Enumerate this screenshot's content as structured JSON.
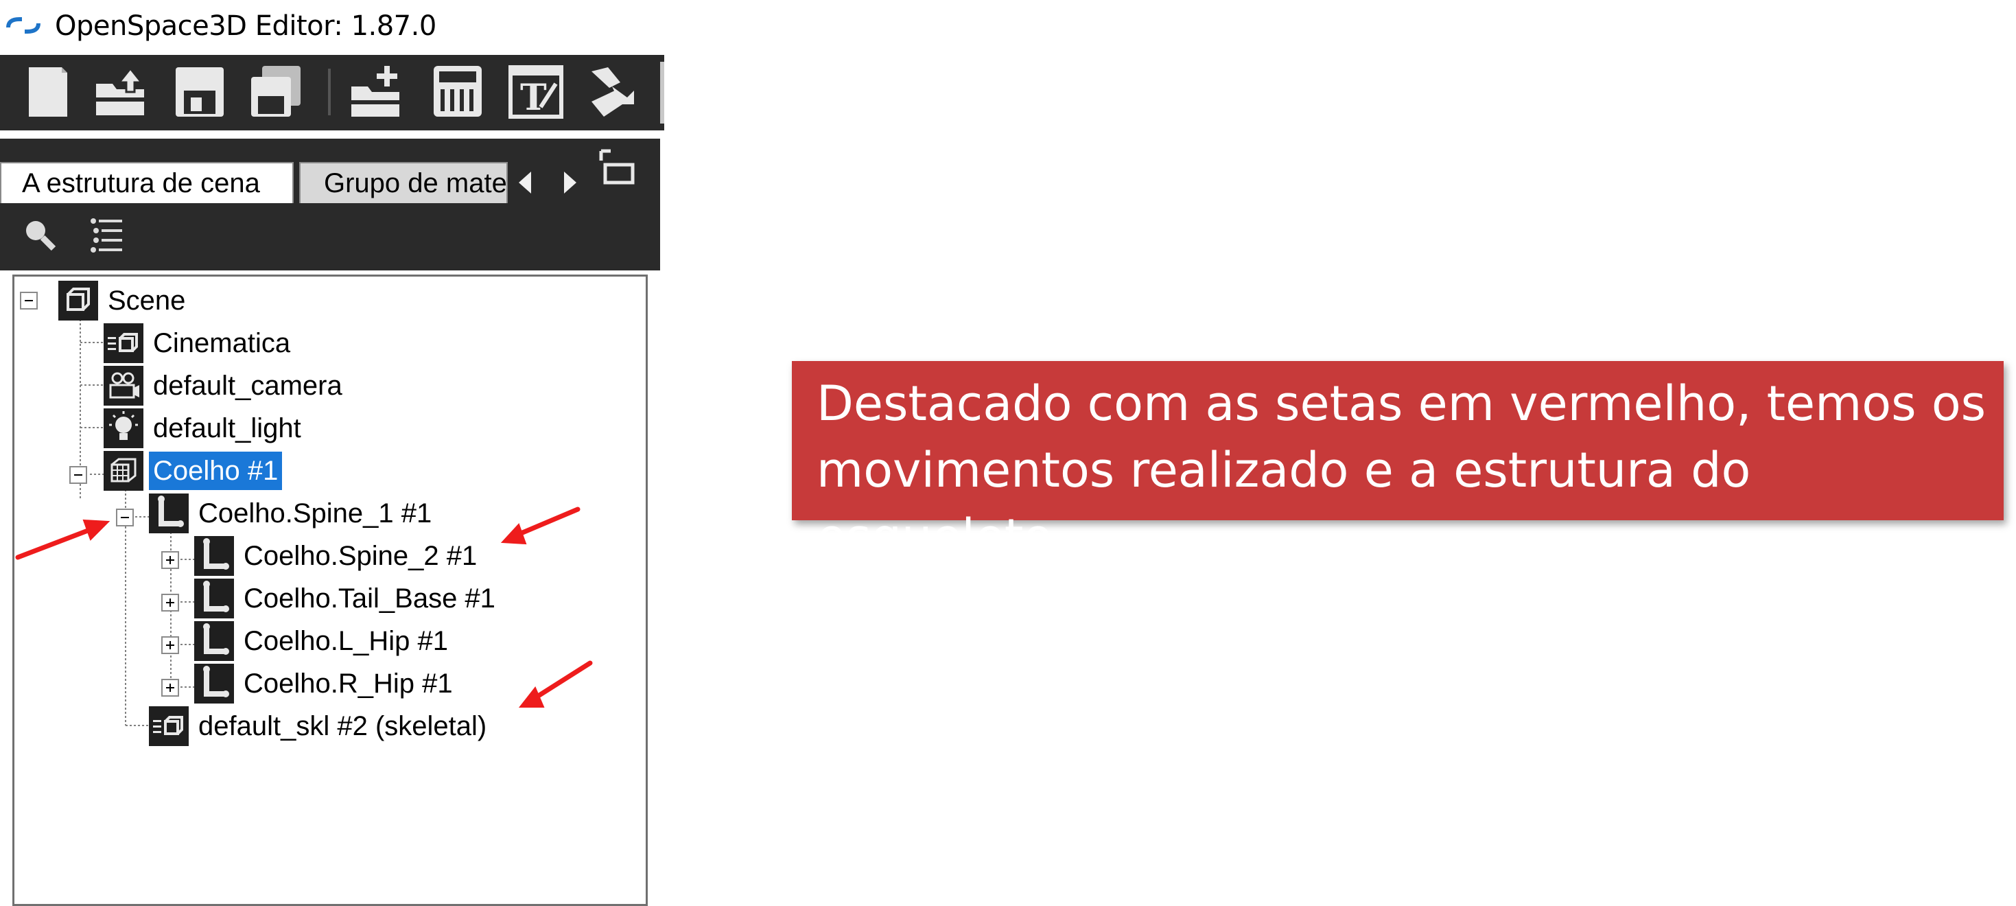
{
  "window": {
    "title": "OpenSpace3D Editor: 1.87.0",
    "app_icon": "openspace3d-logo"
  },
  "toolbar": {
    "buttons": [
      {
        "icon": "new-file-icon"
      },
      {
        "icon": "open-folder-icon"
      },
      {
        "icon": "save-icon"
      },
      {
        "icon": "save-as-icon"
      },
      {
        "icon": "add-folder-icon"
      },
      {
        "icon": "calculator-icon"
      },
      {
        "icon": "text-edit-icon"
      },
      {
        "icon": "export-icon"
      }
    ]
  },
  "panel": {
    "tabs": [
      {
        "label": "A estrutura de cena",
        "active": true
      },
      {
        "label": "Grupo de materiais",
        "active": false
      }
    ],
    "tools": [
      {
        "icon": "search-icon"
      },
      {
        "icon": "list-icon"
      }
    ]
  },
  "tree": {
    "nodes": [
      {
        "label": "Scene",
        "icon": "scene-icon"
      },
      {
        "label": "Cinematica",
        "icon": "animation-icon"
      },
      {
        "label": "default_camera",
        "icon": "camera-icon"
      },
      {
        "label": "default_light",
        "icon": "light-icon"
      },
      {
        "label": "Coelho #1",
        "icon": "mesh-icon",
        "selected": true
      },
      {
        "label": "Coelho.Spine_1 #1",
        "icon": "bone-icon"
      },
      {
        "label": "Coelho.Spine_2 #1",
        "icon": "bone-icon"
      },
      {
        "label": "Coelho.Tail_Base #1",
        "icon": "bone-icon"
      },
      {
        "label": "Coelho.L_Hip #1",
        "icon": "bone-icon"
      },
      {
        "label": "Coelho.R_Hip #1",
        "icon": "bone-icon"
      },
      {
        "label": "default_skl #2 (skeletal)",
        "icon": "animation-icon"
      }
    ]
  },
  "callout": {
    "text": "Destacado com as setas em vermelho, temos os movimentos realizado e a estrutura do esqueleto.",
    "color": "#c73a3a"
  },
  "annotation_color": "#ee1c1c"
}
